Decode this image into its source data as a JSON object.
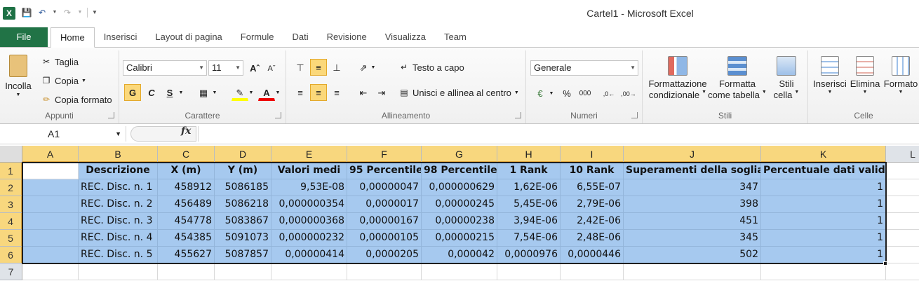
{
  "title": {
    "app_icon": "X",
    "window": "Cartel1  -  Microsoft Excel"
  },
  "tabs": [
    {
      "label": "File"
    },
    {
      "label": "Home"
    },
    {
      "label": "Inserisci"
    },
    {
      "label": "Layout di pagina"
    },
    {
      "label": "Formule"
    },
    {
      "label": "Dati"
    },
    {
      "label": "Revisione"
    },
    {
      "label": "Visualizza"
    },
    {
      "label": "Team"
    }
  ],
  "ribbon": {
    "clipboard": {
      "group": "Appunti",
      "paste": "Incolla",
      "cut": "Taglia",
      "copy": "Copia",
      "format_painter": "Copia formato"
    },
    "font": {
      "group": "Carattere",
      "font_name": "Calibri",
      "font_size": "11",
      "bold": "G",
      "italic": "C",
      "underline": "S"
    },
    "alignment": {
      "group": "Allineamento",
      "wrap": "Testo a capo",
      "merge": "Unisci e allinea al centro"
    },
    "number": {
      "group": "Numeri",
      "format": "Generale",
      "percent": "%",
      "thousands": "000"
    },
    "styles": {
      "group": "Stili",
      "conditional": [
        "Formattazione",
        "condizionale"
      ],
      "as_table": [
        "Formatta",
        "come tabella"
      ],
      "cell_styles": [
        "Stili",
        "cella"
      ]
    },
    "cells": {
      "group": "Celle",
      "insert": "Inserisci",
      "delete": "Elimina",
      "format": "Formato"
    }
  },
  "formula_bar": {
    "name_box": "A1",
    "fx": "fx",
    "formula": ""
  },
  "sheet": {
    "columns": [
      "A",
      "B",
      "C",
      "D",
      "E",
      "F",
      "G",
      "H",
      "I",
      "J",
      "K",
      "L"
    ],
    "rows": [
      "1",
      "2",
      "3",
      "4",
      "5",
      "6",
      "7"
    ],
    "header_row": [
      "",
      "Descrizione",
      "X (m)",
      "Y (m)",
      "Valori medi",
      "95 Percentile",
      "98 Percentile",
      "1 Rank",
      "10 Rank",
      "Superamenti della soglia",
      "Percentuale dati validi"
    ],
    "data": [
      [
        "",
        "REC. Disc. n. 1",
        "458912",
        "5086185",
        "9,53E-08",
        "0,00000047",
        "0,000000629",
        "1,62E-06",
        "6,55E-07",
        "347",
        "1"
      ],
      [
        "",
        "REC. Disc. n. 2",
        "456489",
        "5086218",
        "0,000000354",
        "0,0000017",
        "0,00000245",
        "5,45E-06",
        "2,79E-06",
        "398",
        "1"
      ],
      [
        "",
        "REC. Disc. n. 3",
        "454778",
        "5083867",
        "0,000000368",
        "0,00000167",
        "0,00000238",
        "3,94E-06",
        "2,42E-06",
        "451",
        "1"
      ],
      [
        "",
        "REC. Disc. n. 4",
        "454385",
        "5091073",
        "0,000000232",
        "0,00000105",
        "0,00000215",
        "7,54E-06",
        "2,48E-06",
        "345",
        "1"
      ],
      [
        "",
        "REC. Disc. n. 5",
        "455627",
        "5087857",
        "0,00000414",
        "0,0000205",
        "0,000042",
        "0,0000976",
        "0,0000446",
        "502",
        "1"
      ]
    ]
  }
}
